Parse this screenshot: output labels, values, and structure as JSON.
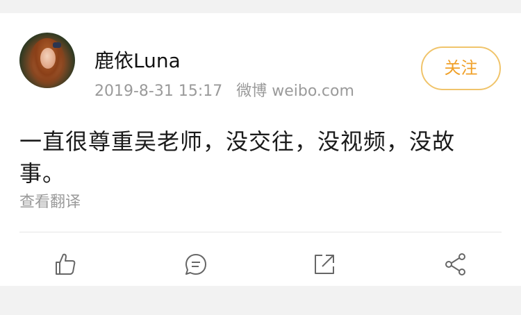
{
  "post": {
    "username": "鹿依Luna",
    "timestamp": "2019-8-31 15:17",
    "source": "微博 weibo.com",
    "follow_label": "关注",
    "text": "一直很尊重吴老师，没交往，没视频，没故事。",
    "translate_label": "查看翻译"
  },
  "actions": {
    "icons": [
      "thumbs-up-icon",
      "comment-icon",
      "repost-icon",
      "share-icon"
    ]
  },
  "colors": {
    "accent": "#f0a028",
    "accent_border": "#f0c46b",
    "meta_text": "#9a9a9a",
    "background": "#f2f2f2"
  }
}
